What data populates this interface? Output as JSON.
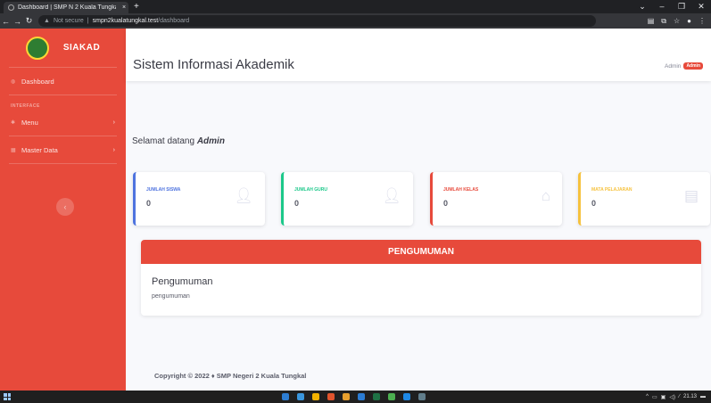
{
  "browser": {
    "tab_title": "Dashboard | SMP N 2 Kuala Tungkal",
    "tab_close": "×",
    "new_tab": "+",
    "security_label": "Not secure",
    "url_host": "smpn2kualatungkal.test",
    "url_path": "/dashboard"
  },
  "sidebar": {
    "brand": "SIAKAD",
    "dashboard_label": "Dashboard",
    "heading": "INTERFACE",
    "menu_label": "Menu",
    "master_label": "Master Data",
    "toggle_glyph": "‹"
  },
  "topbar": {
    "title": "Sistem Informasi Akademik",
    "user_name": "Admin",
    "user_badge": "Admin"
  },
  "welcome": {
    "text": "Selamat datang ",
    "name": "Admin"
  },
  "cards": [
    {
      "label": "JUMLAH SISWA",
      "value": "0",
      "color": "#4e73df",
      "icon": "user-icon"
    },
    {
      "label": "JUMLAH GURU",
      "value": "0",
      "color": "#1cc88a",
      "icon": "user-icon"
    },
    {
      "label": "JUMLAH KELAS",
      "value": "0",
      "color": "#e74a3b",
      "icon": "home-icon"
    },
    {
      "label": "MATA PELAJARAN",
      "value": "0",
      "color": "#f6c23e",
      "icon": "book-icon"
    }
  ],
  "announcement": {
    "header": "PENGUMUMAN",
    "title": "Pengumuman",
    "body": "pengumuman"
  },
  "footer": {
    "text": "Copyright © 2022 ♦ SMP Negeri 2 Kuala Tungkal"
  },
  "taskbar": {
    "time": "21.13"
  }
}
